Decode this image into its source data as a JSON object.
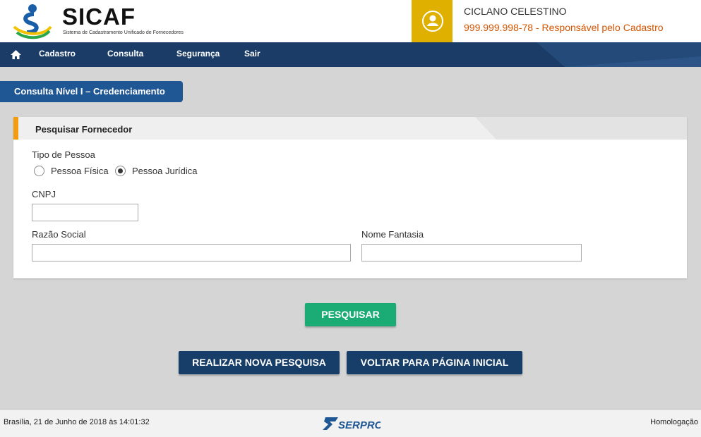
{
  "header": {
    "app_name": "SICAF",
    "app_subtitle": "Sistema de Cadastramento Unificado de Fornecedores",
    "user_name": "CICLANO CELESTINO",
    "user_role": "999.999.998-78 - Responsável pelo Cadastro"
  },
  "nav": {
    "items": [
      {
        "label": "Cadastro"
      },
      {
        "label": "Consulta"
      },
      {
        "label": "Segurança"
      },
      {
        "label": "Sair"
      }
    ]
  },
  "page": {
    "tab_title": "Consulta Nível I – Credenciamento"
  },
  "form": {
    "section_title": "Pesquisar Fornecedor",
    "tipo_pessoa_label": "Tipo de Pessoa",
    "option_fisica": "Pessoa Física",
    "option_juridica": "Pessoa Jurídica",
    "selected_option": "Pessoa Jurídica",
    "cnpj_label": "CNPJ",
    "cnpj_value": "",
    "razao_social_label": "Razão Social",
    "razao_social_value": "",
    "nome_fantasia_label": "Nome Fantasia",
    "nome_fantasia_value": ""
  },
  "actions": {
    "search_label": "PESQUISAR",
    "new_search_label": "REALIZAR NOVA PESQUISA",
    "back_home_label": "VOLTAR PARA PÁGINA INICIAL"
  },
  "footer": {
    "datetime": "Brasília, 21 de Junho de 2018 às 14:01:32",
    "logo_text": "SERPRO",
    "environment": "Homologação"
  },
  "colors": {
    "nav_bg": "#1a3c66",
    "accent_yellow": "#e0b000",
    "accent_orange": "#f39c12",
    "role_text": "#d35400",
    "search_button": "#1aac74",
    "dark_button": "#173e68"
  }
}
